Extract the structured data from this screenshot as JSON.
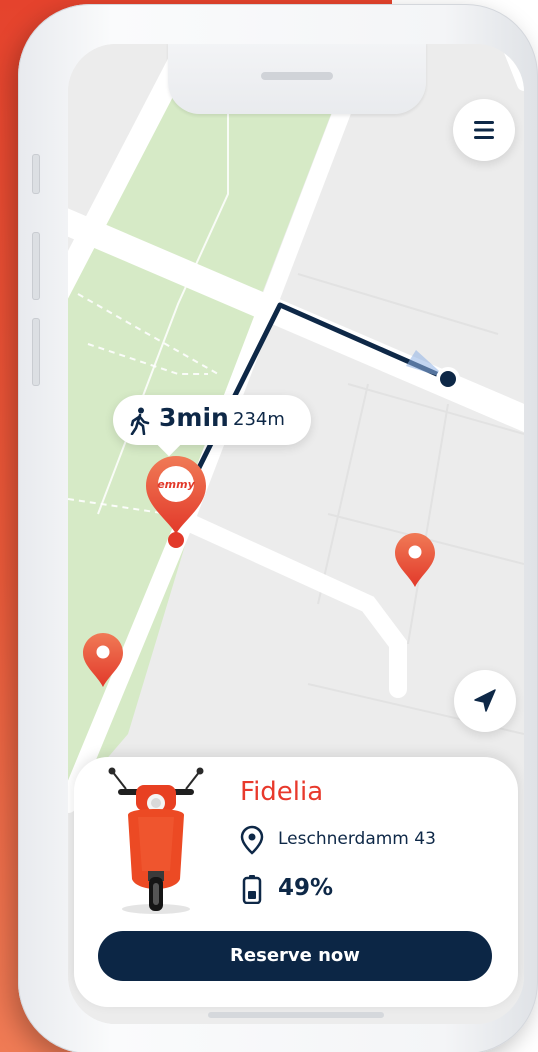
{
  "app": {
    "name": "emmy"
  },
  "map": {
    "menu_icon": "hamburger-menu-icon",
    "locate_icon": "navigation-arrow-icon",
    "walk_bubble": {
      "icon": "walking-person-icon",
      "time": "3min",
      "distance": "234m"
    },
    "selected_pin_label": "emmy",
    "pin_color": "#e8452f",
    "route_color": "#0e2847"
  },
  "scooter_card": {
    "name": "Fidelia",
    "address": "Leschnerdamm 43",
    "address_icon": "location-pin-icon",
    "battery": "49%",
    "battery_icon": "battery-icon",
    "reserve_label": "Reserve now",
    "accent": "#e8392c",
    "button_color": "#0c2645"
  }
}
